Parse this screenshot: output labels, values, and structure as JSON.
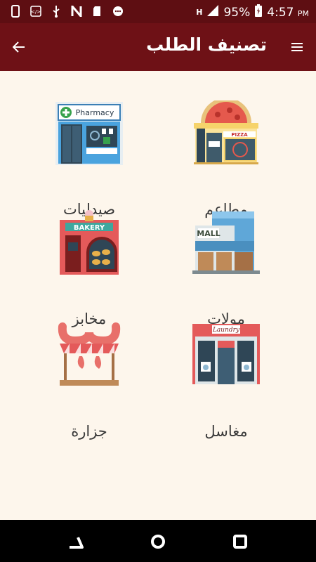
{
  "status_bar": {
    "battery": "95%",
    "time": "4:57",
    "ampm": "PM",
    "network": "H"
  },
  "app_bar": {
    "title": "تصنيف الطلب"
  },
  "categories": [
    {
      "label": "مطاعم",
      "icon": "restaurant-icon"
    },
    {
      "label": "صيدليات",
      "icon": "pharmacy-icon",
      "sign": "Pharmacy"
    },
    {
      "label": "مولات",
      "icon": "mall-icon",
      "sign": "MALL"
    },
    {
      "label": "مخابز",
      "icon": "bakery-icon",
      "sign": "BAKERY"
    },
    {
      "label": "مغاسل",
      "icon": "laundry-icon",
      "sign": "Laundry"
    },
    {
      "label": "جزارة",
      "icon": "butcher-icon"
    }
  ],
  "colors": {
    "status_bar": "#5e0e12",
    "app_bar": "#6e1116",
    "background": "#fdf6ec"
  }
}
